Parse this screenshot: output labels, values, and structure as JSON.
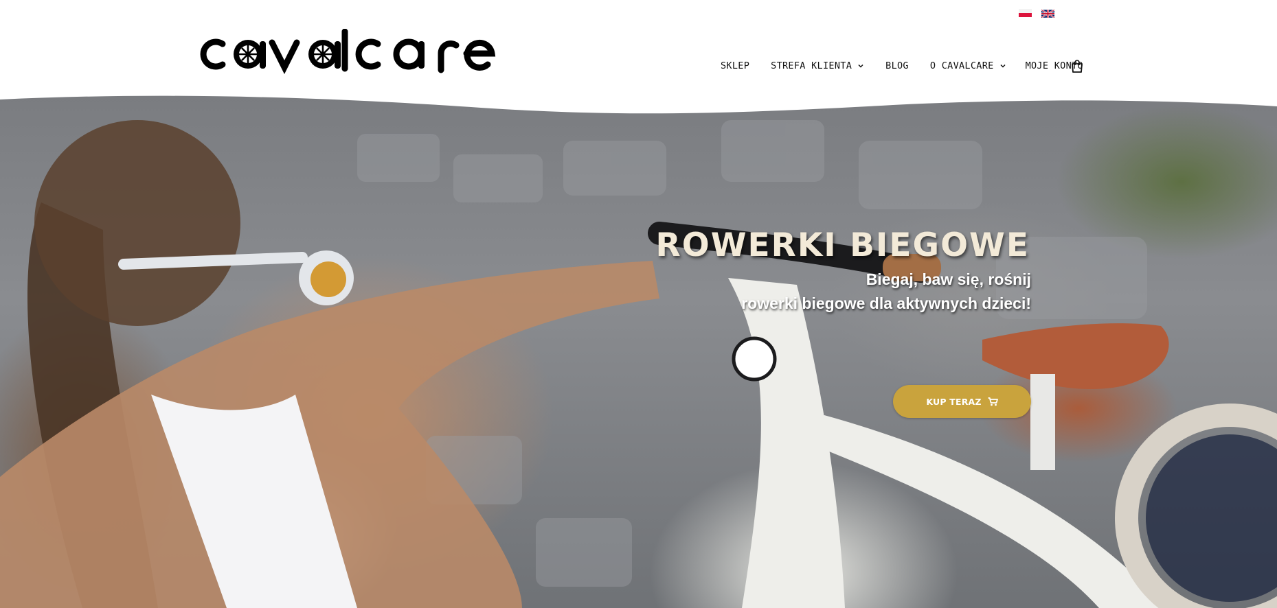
{
  "languages": [
    {
      "code": "pl",
      "icon": "poland-flag-icon"
    },
    {
      "code": "en",
      "icon": "uk-flag-icon"
    }
  ],
  "logo": {
    "text": "cavalcare"
  },
  "nav": {
    "items": [
      {
        "label": "SKLEP",
        "has_dropdown": false
      },
      {
        "label": "STREFA KLIENTA",
        "has_dropdown": true
      },
      {
        "label": "BLOG",
        "has_dropdown": false
      },
      {
        "label": "O CAVALCARE",
        "has_dropdown": true
      },
      {
        "label": "MOJE KONTO",
        "has_dropdown": false
      }
    ],
    "cart_icon": "shopping-bag-icon"
  },
  "hero": {
    "title": "ROWERKI BIEGOWE",
    "subtitle_line1": "Biegaj, baw się, rośnij",
    "subtitle_line2": "rowerki biegowe dla aktywnych dzieci!",
    "cta_label": "KUP TERAZ",
    "cta_icon": "shopping-cart-icon",
    "cta_color": "#c9a33d",
    "title_color": "#f3ead8"
  }
}
